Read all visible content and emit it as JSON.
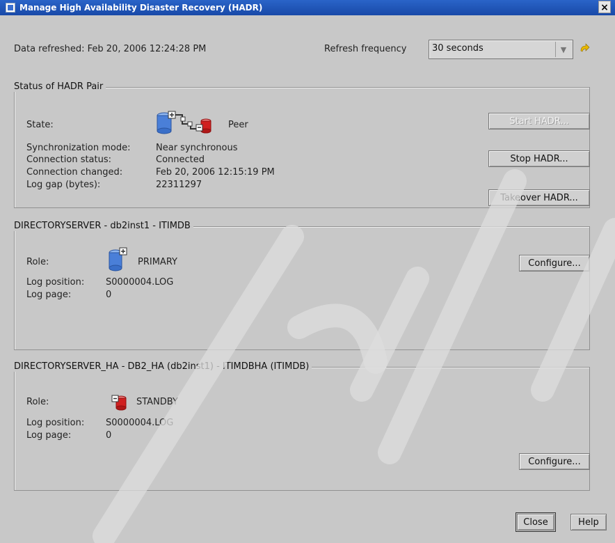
{
  "window": {
    "title": "Manage High Availability Disaster Recovery (HADR)",
    "close_glyph": "×"
  },
  "header": {
    "data_refreshed": "Data refreshed: Feb 20, 2006 12:24:28 PM",
    "refresh_frequency_label": "Refresh frequency",
    "refresh_frequency_value": "30 seconds",
    "dropdown_arrow": "▼",
    "refresh_icon": "refresh-arrow"
  },
  "status": {
    "title": "Status of HADR Pair",
    "state_label": "State:",
    "state_value": "Peer",
    "sync_mode_label": "Synchronization mode:",
    "sync_mode_value": "Near synchronous",
    "conn_status_label": "Connection status:",
    "conn_status_value": "Connected",
    "conn_changed_label": "Connection changed:",
    "conn_changed_value": "Feb 20, 2006 12:15:19 PM",
    "log_gap_label": "Log gap (bytes):",
    "log_gap_value": "22311297",
    "start_button": "Start HADR...",
    "stop_button": "Stop HADR...",
    "takeover_button": "Takeover HADR..."
  },
  "primary": {
    "title": "DIRECTORYSERVER - db2inst1 - ITIMDB",
    "role_label": "Role:",
    "role_value": "PRIMARY",
    "log_position_label": "Log position:",
    "log_position_value": "S0000004.LOG",
    "log_page_label": "Log page:",
    "log_page_value": "0",
    "configure_button": "Configure..."
  },
  "standby": {
    "title": "DIRECTORYSERVER_HA - DB2_HA (db2inst1)  - ITIMDBHA (ITIMDB)",
    "role_label": "Role:",
    "role_value": "STANDBY",
    "log_position_label": "Log position:",
    "log_position_value": "S0000004.LOG",
    "log_page_label": "Log page:",
    "log_page_value": "0",
    "configure_button": "Configure..."
  },
  "footer": {
    "close_button": "Close",
    "help_button": "Help"
  },
  "colors": {
    "titlebar": "#1e52b8",
    "window_bg": "#c8c8c8",
    "primary_db": "#4a7fd8",
    "standby_db": "#d02020"
  }
}
